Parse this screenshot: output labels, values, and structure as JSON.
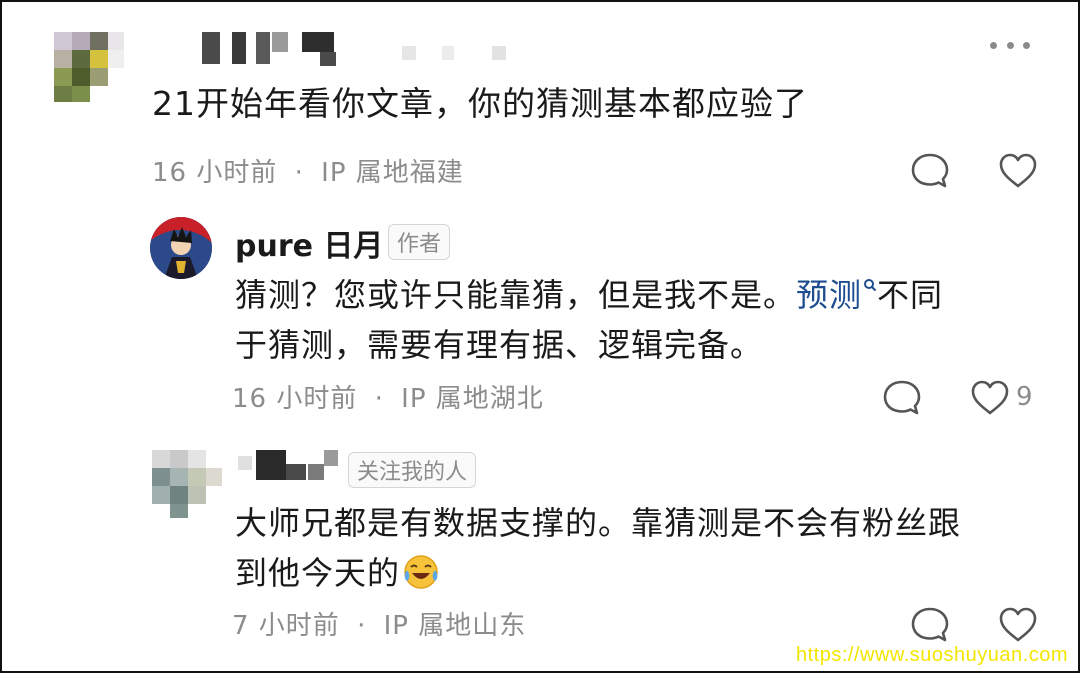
{
  "comment1": {
    "text": "21开始年看你文章，你的猜测基本都应验了",
    "time": "16 小时前",
    "sep": "·",
    "ip": "IP 属地福建"
  },
  "reply1": {
    "author": "pure 日月",
    "tag": "作者",
    "text_before": "猜测？您或许只能靠猜，但是我不是。",
    "link": "预测",
    "text_line1_after": "不同",
    "text_line2": "于猜测，需要有理有据、逻辑完备。",
    "time": "16 小时前",
    "sep": "·",
    "ip": "IP 属地湖北",
    "likes": "9"
  },
  "reply2": {
    "tag": "关注我的人",
    "text_line1": "大师兄都是有数据支撑的。靠猜测是不会有粉丝跟",
    "text_line2": "到他今天的",
    "time": "7 小时前",
    "sep": "·",
    "ip": "IP 属地山东"
  },
  "icons": {
    "more": "more-dots-icon",
    "comment": "comment-bubble-icon",
    "like": "heart-icon",
    "search": "search-icon",
    "emoji": "laughing-crying-emoji-icon"
  },
  "watermark": "https://www.suoshuyuan.com"
}
